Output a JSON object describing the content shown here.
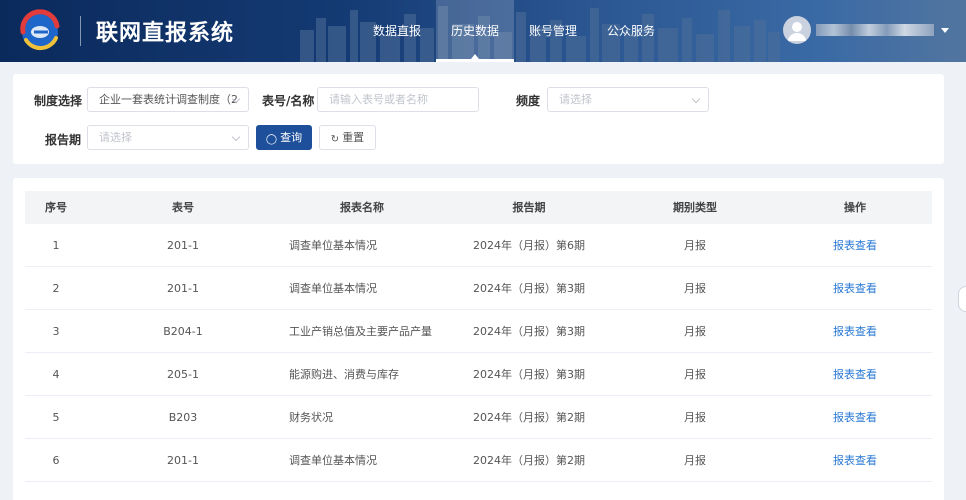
{
  "header": {
    "app_title": "联网直报系统",
    "nav": [
      {
        "label": "数据直报",
        "active": false
      },
      {
        "label": "历史数据",
        "active": true
      },
      {
        "label": "账号管理",
        "active": false
      },
      {
        "label": "公众服务",
        "active": false
      }
    ],
    "logo_icon": "globe-logo-icon",
    "avatar_icon": "user-avatar-icon"
  },
  "filters": {
    "system_label": "制度选择",
    "system_value": "企业一套表统计调查制度（2",
    "form_label": "表号/名称",
    "form_placeholder": "请输入表号或者名称",
    "frequency_label": "频度",
    "frequency_placeholder": "请选择",
    "period_label": "报告期",
    "period_placeholder": "请选择",
    "query_button": "查询",
    "reset_button": "重置"
  },
  "table": {
    "headers": [
      "序号",
      "表号",
      "报表名称",
      "报告期",
      "期别类型",
      "操作"
    ],
    "rows": [
      {
        "index": "1",
        "code": "201-1",
        "name": "调查单位基本情况",
        "period": "2024年（月报）第6期",
        "type": "月报",
        "action": "报表查看"
      },
      {
        "index": "2",
        "code": "201-1",
        "name": "调查单位基本情况",
        "period": "2024年（月报）第3期",
        "type": "月报",
        "action": "报表查看"
      },
      {
        "index": "3",
        "code": "B204-1",
        "name": "工业产销总值及主要产品产量",
        "period": "2024年（月报）第3期",
        "type": "月报",
        "action": "报表查看"
      },
      {
        "index": "4",
        "code": "205-1",
        "name": "能源购进、消费与库存",
        "period": "2024年（月报）第3期",
        "type": "月报",
        "action": "报表查看"
      },
      {
        "index": "5",
        "code": "B203",
        "name": "财务状况",
        "period": "2024年（月报）第2期",
        "type": "月报",
        "action": "报表查看"
      },
      {
        "index": "6",
        "code": "201-1",
        "name": "调查单位基本情况",
        "period": "2024年（月报）第2期",
        "type": "月报",
        "action": "报表查看"
      }
    ]
  },
  "colors": {
    "primary": "#1d4f9a",
    "link": "#2a78d4",
    "header_bg": "#143a73"
  }
}
